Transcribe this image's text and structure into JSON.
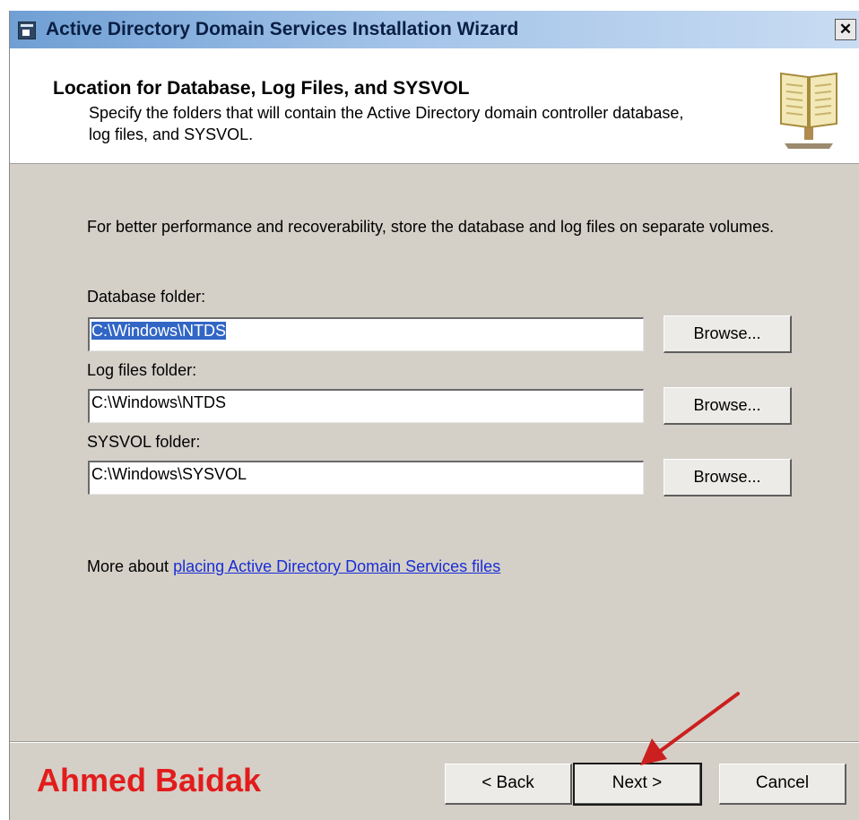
{
  "window": {
    "title": "Active Directory Domain Services Installation Wizard",
    "close_glyph": "✕"
  },
  "header": {
    "heading": "Location for Database, Log Files, and SYSVOL",
    "subheading": "Specify the folders that will contain the Active Directory domain controller database, log files, and SYSVOL.",
    "icon": "book-icon"
  },
  "content": {
    "intro": "For better performance and recoverability, store the database and log files on separate volumes.",
    "fields": [
      {
        "label": "Database folder:",
        "value": "C:\\Windows\\NTDS",
        "selected": true,
        "browse_label": "Browse..."
      },
      {
        "label": "Log files folder:",
        "value": "C:\\Windows\\NTDS",
        "selected": false,
        "browse_label": "Browse..."
      },
      {
        "label": "SYSVOL folder:",
        "value": "C:\\Windows\\SYSVOL",
        "selected": false,
        "browse_label": "Browse..."
      }
    ],
    "more_prefix": "More about ",
    "more_link": "placing Active Directory Domain Services files"
  },
  "footer": {
    "watermark": "Ahmed Baidak",
    "back_label": "< Back",
    "next_label": "Next >",
    "cancel_label": "Cancel"
  },
  "colors": {
    "accent_arrow": "#cc1f1f",
    "watermark": "#e21c1c",
    "link": "#1a2dd6",
    "selection": "#3166c5"
  }
}
